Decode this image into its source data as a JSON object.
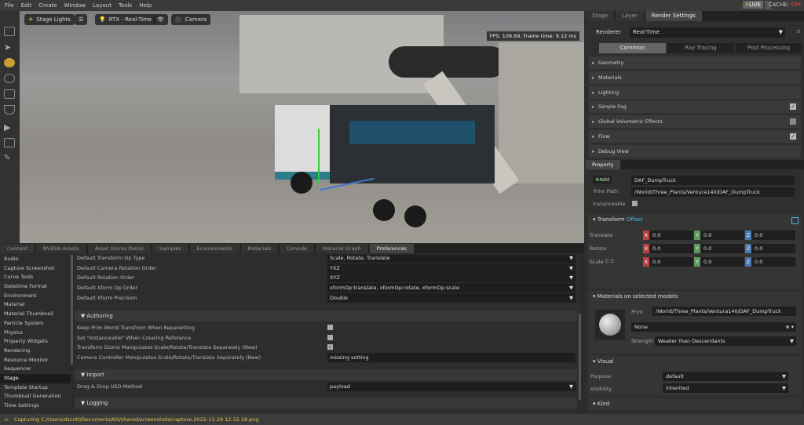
{
  "menu": [
    "File",
    "Edit",
    "Create",
    "Window",
    "Layout",
    "Tools",
    "Help"
  ],
  "live": "LIVE",
  "cache_label": "CACHE:",
  "cache_state": "OFF",
  "viewport": {
    "stage_lights": "Stage Lights",
    "renderer": "RTX - Real-Time",
    "camera": "Camera",
    "fps": "FPS: 109.69, Frame time: 9.12 ms"
  },
  "render_panel": {
    "tabs": [
      "Stage",
      "Layer",
      "Render Settings"
    ],
    "renderer_label": "Renderer",
    "renderer_value": "Real-Time",
    "subtabs": [
      "Common",
      "Ray Tracing",
      "Post Processing"
    ],
    "sections": [
      {
        "label": "Geometry"
      },
      {
        "label": "Materials"
      },
      {
        "label": "Lighting"
      },
      {
        "label": "Simple Fog",
        "check": "✓"
      },
      {
        "label": "Global Volumetric Effects",
        "check": ""
      },
      {
        "label": "Flow",
        "check": "✓"
      },
      {
        "label": "Debug View"
      }
    ]
  },
  "property": {
    "tab": "Property",
    "add": "Add",
    "name": "DAF_DumpTruck",
    "prim_path_label": "Prim Path",
    "prim_path": "/World/Three_Plants/Ventura140/DAF_DumpTruck",
    "instanceable_label": "Instanceable",
    "transform": {
      "title": "Transform",
      "offset": "Offset",
      "rows": [
        {
          "label": "Translate",
          "x": "0.0",
          "y": "0.0",
          "z": "0.0"
        },
        {
          "label": "Rotate",
          "x": "0.0",
          "y": "0.0",
          "z": "0.0"
        },
        {
          "label": "Scale",
          "x": "0.0",
          "y": "0.0",
          "z": "0.0"
        }
      ]
    },
    "materials": {
      "title": "Materials on selected models",
      "prim_label": "Prim",
      "prim": "/World/Three_Plants/Ventura140/DAF_DumpTruck",
      "material": "None",
      "strength_label": "Strength",
      "strength": "Weaker than Descendants"
    },
    "visual": {
      "title": "Visual",
      "purpose_label": "Purpose",
      "purpose": "default",
      "visibility_label": "Visibility",
      "visibility": "inherited"
    },
    "kind": {
      "title": "Kind"
    }
  },
  "bottom_tabs": [
    "Content",
    "NVIDIA Assets",
    "Asset Stores (beta)",
    "Samples",
    "Environments",
    "Materials",
    "Console",
    "Material Graph",
    "Preferences"
  ],
  "pref_list": [
    "Audio",
    "Capture Screenshot",
    "Curve Tools",
    "Datetime Format",
    "Environment",
    "Material",
    "Material Thumbnail",
    "Particle System",
    "Physics",
    "Property Widgets",
    "Rendering",
    "Resource Monitor",
    "Sequencer",
    "Stage",
    "Template Startup",
    "Thumbnail Generation",
    "Time Settings"
  ],
  "prefs": {
    "rows": [
      {
        "label": "Default Transform Op Type",
        "value": "Scale, Rotate, Translate"
      },
      {
        "label": "Default Camera Rotation Order",
        "value": "YXZ"
      },
      {
        "label": "Default Rotation Order",
        "value": "XYZ"
      },
      {
        "label": "Default Xform Op Order",
        "value": "xformOp:translate, xformOp:rotate, xformOp:scale"
      },
      {
        "label": "Default Xform Precision",
        "value": "Double"
      }
    ],
    "authoring": "Authoring",
    "auth_rows": [
      "Keep Prim World Transfrom When Reparenting",
      "Set \"Instanceable\" When Creating Reference",
      "Transform Gizmo Manipulates Scale/Rotate/Translate Separately (New)",
      "Camera Controller Manipulates Scale/Rotate/Translate Separately (New)"
    ],
    "missing": "missing setting",
    "import": "Import",
    "dragdrop_label": "Drag & Drop USD Method",
    "dragdrop": "payload",
    "logging": "Logging"
  },
  "status": "Capturing C:/Users/dscott/Documents/Kit/shared/screenshots/capture.2022-11-29 12.32.18.png"
}
